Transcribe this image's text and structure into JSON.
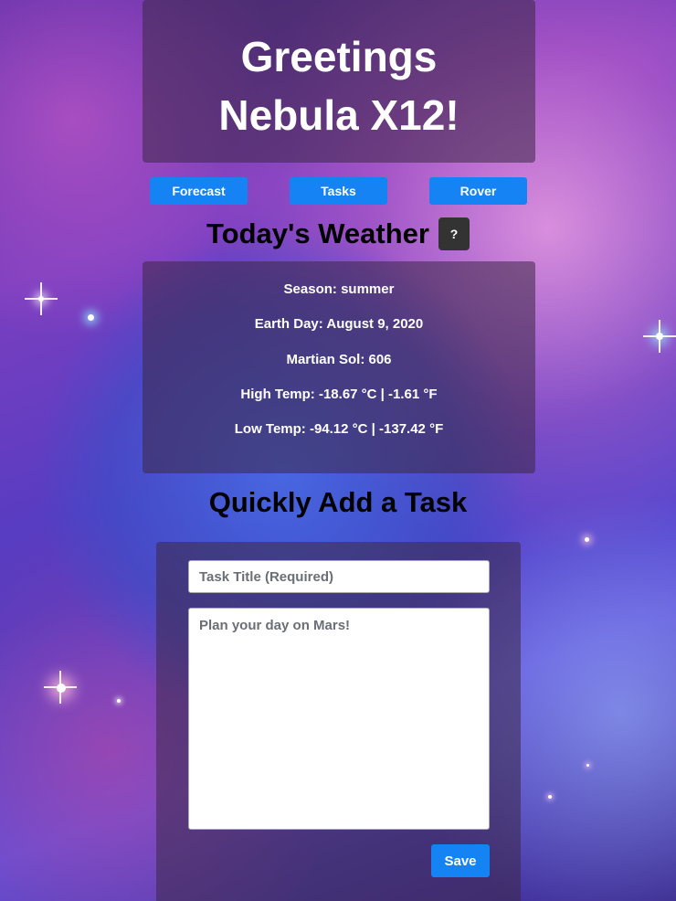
{
  "header": {
    "greeting_line1": "Greetings",
    "greeting_line2": "Nebula X12!"
  },
  "nav": {
    "forecast": "Forecast",
    "tasks": "Tasks",
    "rover": "Rover"
  },
  "weather": {
    "title": "Today's Weather",
    "help_label": "?",
    "season": "Season: summer",
    "earth_day": "Earth Day: August 9, 2020",
    "martian_sol": "Martian Sol: 606",
    "high_temp": "High Temp: -18.67 °C | -1.61 °F",
    "low_temp": "Low Temp: -94.12 °C | -137.42 °F"
  },
  "task_form": {
    "title": "Quickly Add a Task",
    "title_placeholder": "Task Title (Required)",
    "body_placeholder": "Plan your day on Mars!",
    "save_label": "Save"
  },
  "colors": {
    "accent": "#1683f5",
    "help_button": "#333333"
  }
}
